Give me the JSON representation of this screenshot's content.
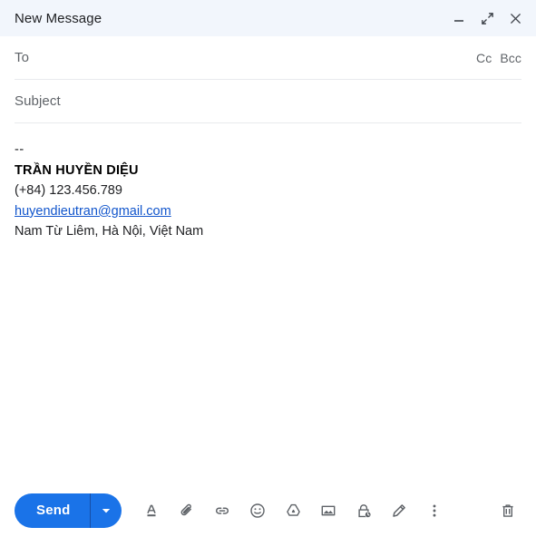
{
  "header": {
    "title": "New Message",
    "minimize_label": "minimize",
    "fullscreen_label": "full screen",
    "close_label": "close"
  },
  "fields": {
    "to_label": "To",
    "cc_label": "Cc",
    "bcc_label": "Bcc",
    "subject_placeholder": "Subject",
    "to_value": "",
    "subject_value": ""
  },
  "body": {
    "signature_delimiter": "--",
    "signature_name": "TRẦN HUYỀN DIỆU",
    "signature_phone": "(+84) 123.456.789",
    "signature_email": "huyendieutran@gmail.com",
    "signature_address": "Nam Từ Liêm, Hà Nội, Việt Nam"
  },
  "footer": {
    "send_label": "Send",
    "send_options_label": "more send options",
    "icons": [
      {
        "name": "formatting-options-icon",
        "label": "Formatting options"
      },
      {
        "name": "attach-file-icon",
        "label": "Attach files"
      },
      {
        "name": "insert-link-icon",
        "label": "Insert link"
      },
      {
        "name": "insert-emoji-icon",
        "label": "Insert emoji"
      },
      {
        "name": "insert-drive-file-icon",
        "label": "Insert files using Drive"
      },
      {
        "name": "insert-photo-icon",
        "label": "Insert photo"
      },
      {
        "name": "confidential-mode-icon",
        "label": "Toggle confidential mode"
      },
      {
        "name": "insert-signature-icon",
        "label": "Insert signature"
      },
      {
        "name": "more-options-icon",
        "label": "More options"
      }
    ],
    "discard_label": "Discard draft"
  },
  "colors": {
    "header_background": "#f2f6fc",
    "send_button": "#1a73e8",
    "link": "#1155cc",
    "icon": "#5f6368",
    "text": "#202124",
    "divider": "#e8eaed"
  }
}
